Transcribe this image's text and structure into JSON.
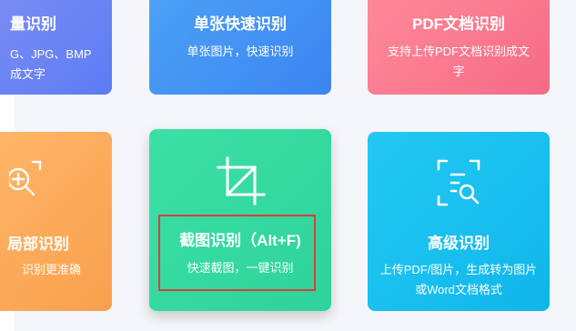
{
  "cards": {
    "format": {
      "title": "量识别",
      "desc_line1": "G、JPG、BMP",
      "desc_line2": "成文字",
      "color": "#5b7cf2"
    },
    "single": {
      "title": "单张快速识别",
      "desc": "单张图片，快速识别",
      "color": "#3b84f2"
    },
    "pdf": {
      "title": "PDF文档识别",
      "desc": "支持上传PDF文档识别成文字",
      "color": "#f56b86"
    },
    "local": {
      "title": "局部识别",
      "desc": "识别更准确",
      "icon": "zoom-in-icon",
      "color": "#f8a04e"
    },
    "screenshot": {
      "title": "截图识别（Alt+F)",
      "desc": "快速截图，一键识别",
      "icon": "crop-icon",
      "color": "#2dd39b",
      "highlight_color": "#d8403a"
    },
    "advanced": {
      "title": "高级识别",
      "desc": "上传PDF/图片，生成转为图片或Word文档格式",
      "icon": "document-search-icon",
      "color": "#10b6ea"
    }
  }
}
